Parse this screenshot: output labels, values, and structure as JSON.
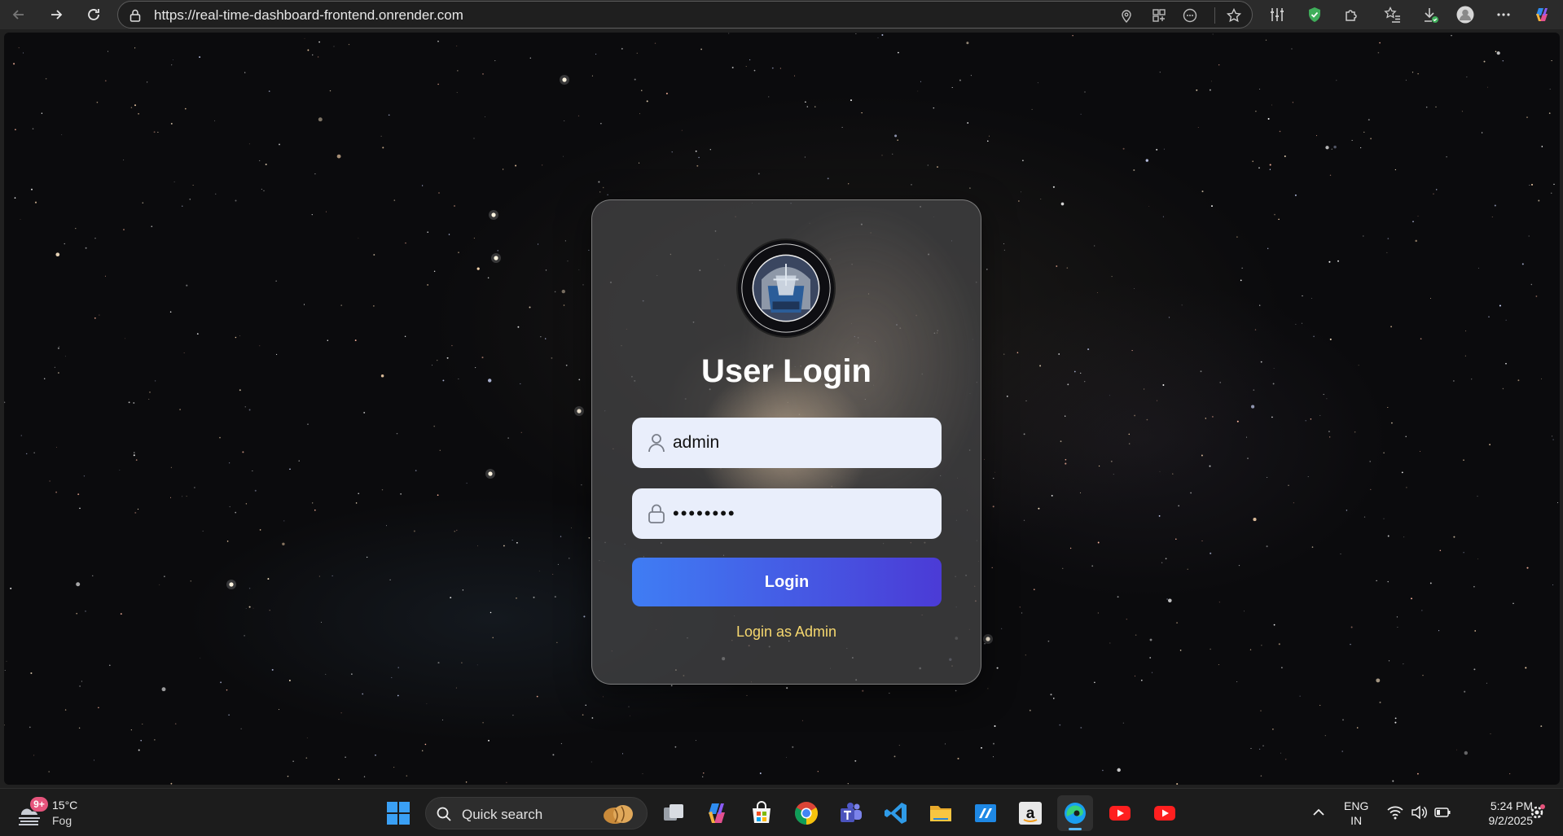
{
  "browser": {
    "url": "https://real-time-dashboard-frontend.onrender.com"
  },
  "login": {
    "logo_alt": "3.6m Devasthal Optical Telescope (DOT) Nainital India",
    "title": "User Login",
    "username_value": "admin",
    "password_value": "password",
    "login_button": "Login",
    "admin_link": "Login as Admin"
  },
  "taskbar": {
    "weather_badge": "9+",
    "temperature": "15°C",
    "condition": "Fog",
    "search_label": "Quick search",
    "language_line1": "ENG",
    "language_line2": "IN",
    "time": "5:24 PM",
    "date": "9/2/2025"
  },
  "colors": {
    "login_gradient_start": "#3f7df4",
    "login_gradient_end": "#4b3bd6",
    "admin_link": "#f5d76e",
    "input_bg": "#e9eefb"
  }
}
